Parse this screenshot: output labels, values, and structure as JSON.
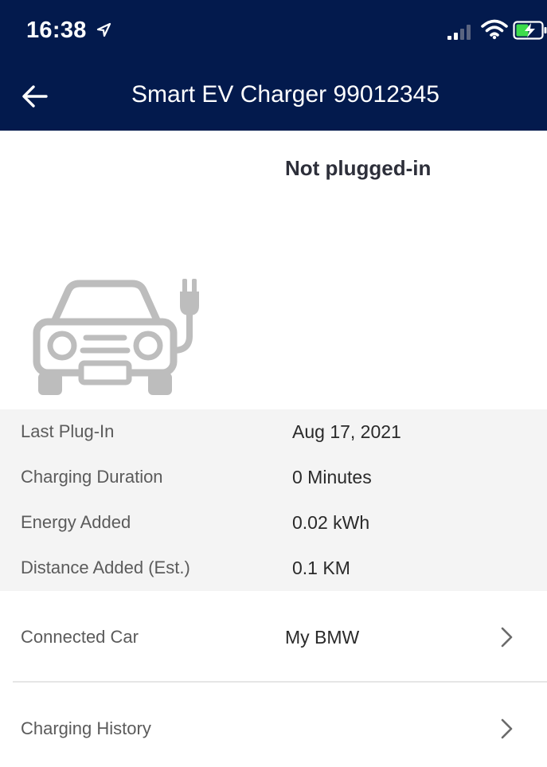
{
  "status_bar": {
    "time": "16:38",
    "icons": [
      "location-arrow-icon",
      "cellular-signal-icon",
      "wifi-icon",
      "battery-charging-icon"
    ]
  },
  "header": {
    "title": "Smart EV Charger 99012345",
    "back_icon": "back-arrow-icon"
  },
  "charger": {
    "status": "Not plugged-in",
    "illustration": "car-with-plug-icon"
  },
  "stats": [
    {
      "label": "Last Plug-In",
      "value": "Aug 17, 2021"
    },
    {
      "label": "Charging Duration",
      "value": "0 Minutes"
    },
    {
      "label": "Energy Added",
      "value": "0.02 kWh"
    },
    {
      "label": "Distance Added (Est.)",
      "value": "0.1 KM"
    }
  ],
  "connected_car": {
    "label": "Connected Car",
    "value": "My BMW"
  },
  "charging_history": {
    "label": "Charging History"
  },
  "colors": {
    "header_bg": "#031a4d",
    "stats_bg": "#f4f4f4",
    "icon_gray": "#bdbdbd",
    "battery_green": "#3ddc4b"
  }
}
